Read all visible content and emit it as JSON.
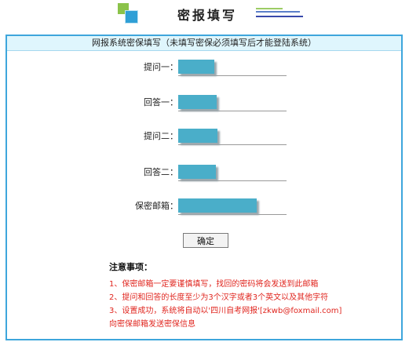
{
  "header": {
    "title": "密报填写"
  },
  "panel": {
    "heading": "网报系统密保填写（未填写密保必须填写后才能登陆系统）"
  },
  "form": {
    "q1_label": "提问一：",
    "a1_label": "回答一：",
    "q2_label": "提问二：",
    "a2_label": "回答二：",
    "email_label": "保密邮箱："
  },
  "submit_label": "确定",
  "notes": {
    "title": "注意事项：",
    "items": [
      "1、保密邮箱一定要谨慎填写，找回的密码将会发送到此邮箱",
      "2、提问和回答的长度至少为3个汉字或者3个英文以及其他字符",
      "3、设置成功，系统将自动以'四川自考网报'[zkwb@foxmail.com]",
      "向密保邮箱发送密保信息"
    ]
  },
  "colors": {
    "accent": "#3ea6dc",
    "header_bg": "#dff6fd",
    "notice_red": "#e0261f",
    "redaction": "#4aaec9"
  },
  "icons": {
    "logo": "green-blue-squares-logo-icon"
  }
}
